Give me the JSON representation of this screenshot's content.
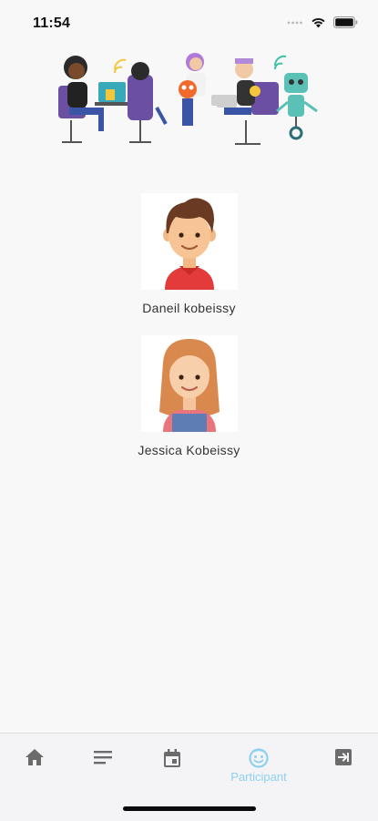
{
  "status": {
    "time": "11:54"
  },
  "participants": [
    {
      "name": "Daneil kobeissy",
      "avatar_icon": "boy-avatar"
    },
    {
      "name": "Jessica Kobeissy",
      "avatar_icon": "girl-avatar"
    }
  ],
  "tabbar": {
    "items": [
      {
        "icon": "home-icon",
        "label": ""
      },
      {
        "icon": "list-icon",
        "label": ""
      },
      {
        "icon": "calendar-icon",
        "label": ""
      },
      {
        "icon": "participant-face-icon",
        "label": "Participant",
        "active": true
      },
      {
        "icon": "logout-icon",
        "label": ""
      }
    ]
  },
  "colors": {
    "active_tab": "#8fd0f0",
    "inactive_icon": "#6b6b6b",
    "background": "#f8f8f9"
  }
}
